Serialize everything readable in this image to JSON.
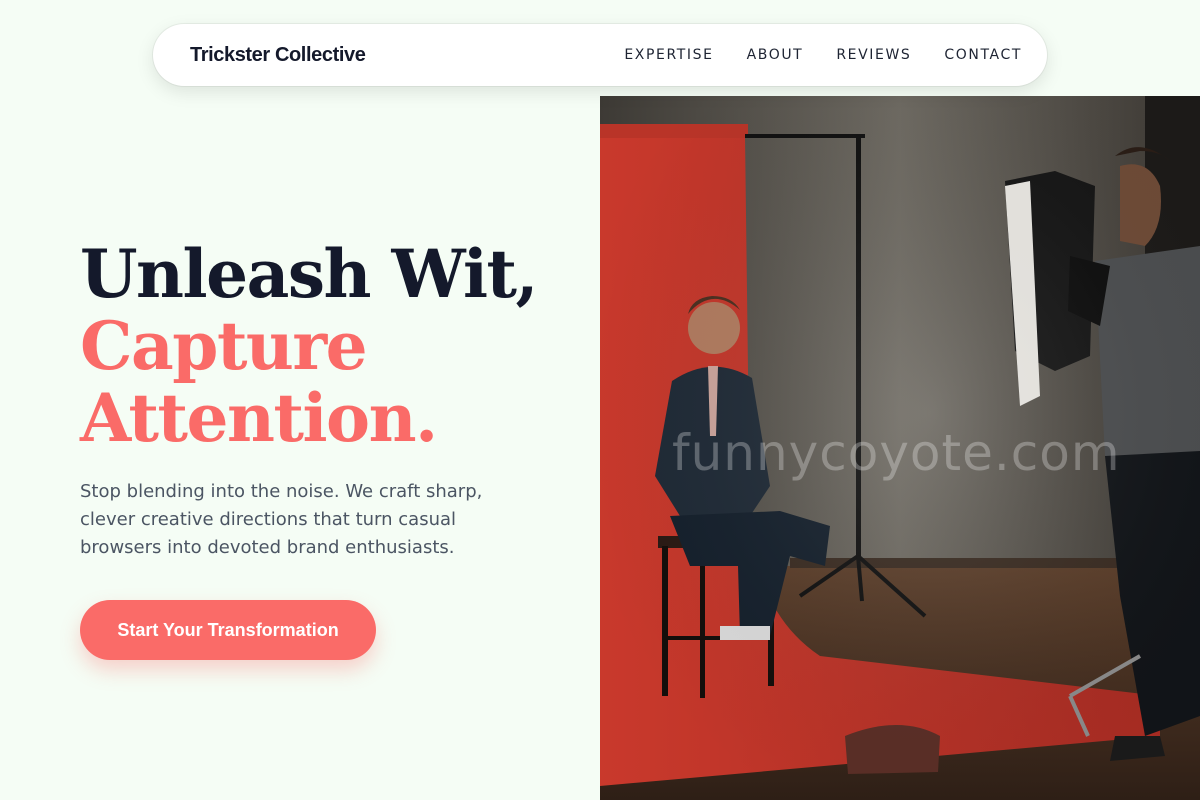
{
  "nav": {
    "brand": "Trickster Collective",
    "links": [
      "EXPERTISE",
      "ABOUT",
      "REVIEWS",
      "CONTACT"
    ]
  },
  "hero": {
    "headline_line1": "Unleash Wit,",
    "headline_line2": "Capture",
    "headline_line3": "Attention.",
    "subtext": "Stop blending into the noise. We craft sharp, clever creative directions that turn casual browsers into devoted brand enthusiasts.",
    "cta_label": "Start Your Transformation"
  },
  "photo": {
    "watermark": "funnycoyote.com"
  },
  "colors": {
    "background": "#f5fdf5",
    "dark": "#14192b",
    "accent": "#fa6b68",
    "body_text": "#4b5563"
  }
}
